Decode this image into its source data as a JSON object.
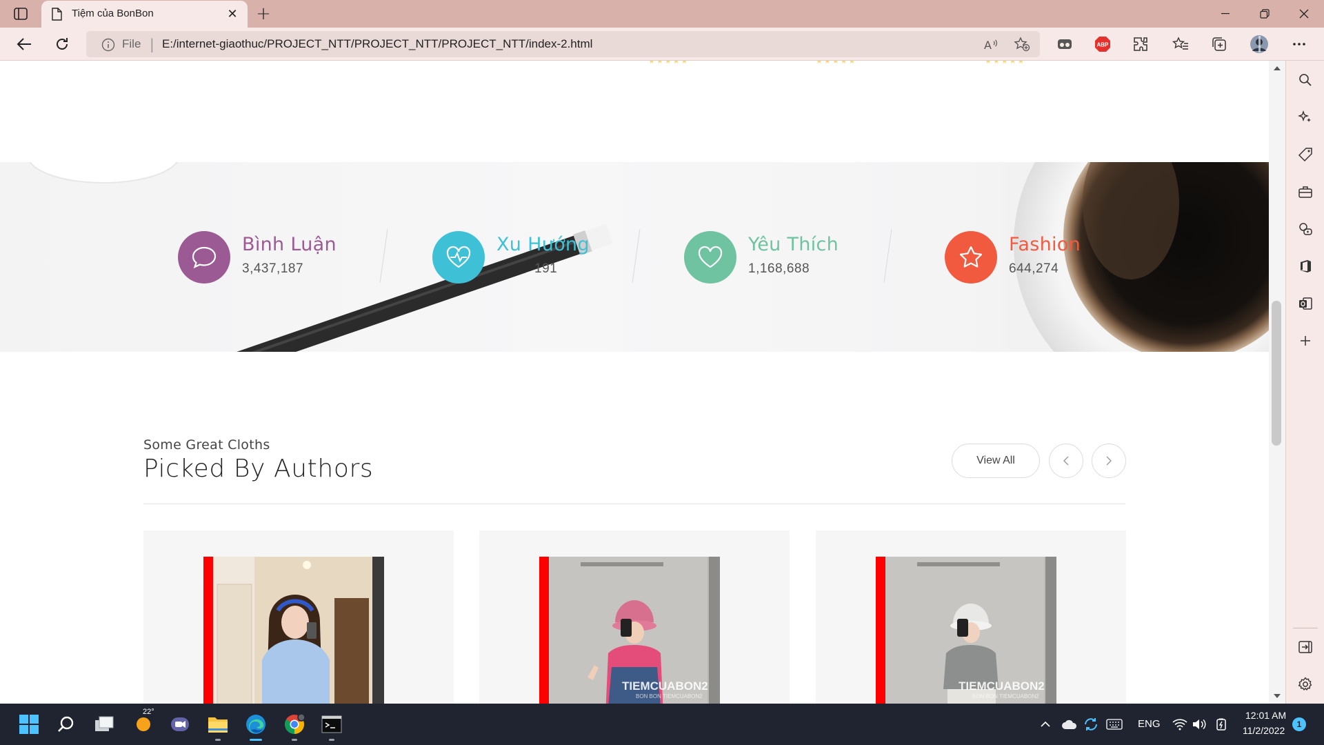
{
  "browser": {
    "tab_title": "Tiệm của BonBon",
    "address_scheme": "File",
    "address_url": "E:/internet-giaothuc/PROJECT_NTT/PROJECT_NTT/PROJECT_NTT/index-2.html"
  },
  "counters": [
    {
      "title": "Bình Luận",
      "value": "3,437,187",
      "color": "#9b5a93",
      "icon": "chat-icon"
    },
    {
      "title": "Xu Hướng",
      "value": "191",
      "color": "#3ec1d6",
      "icon": "heartbeat-icon"
    },
    {
      "title": "Yêu Thích",
      "value": "1,168,688",
      "color": "#6fc3a0",
      "icon": "heart-icon"
    },
    {
      "title": "Fashion",
      "value": "644,274",
      "color": "#f15a3f",
      "icon": "star-icon"
    }
  ],
  "section": {
    "subtitle": "Some Great Cloths",
    "title": "Picked By Authors",
    "view_all_label": "View All"
  },
  "products": [
    {
      "watermark": ""
    },
    {
      "watermark": "TIEMCUABON2",
      "watermark_sub": "BON BON TIEMCUABON2"
    },
    {
      "watermark": "TIEMCUABON2",
      "watermark_sub": "BON BON TIEMCUABON2"
    }
  ],
  "taskbar": {
    "weather_temp": "22°",
    "language": "ENG",
    "time": "12:01 AM",
    "date": "11/2/2022",
    "notification_count": "1"
  },
  "colors": {
    "accent_purple": "#9b5a93",
    "accent_cyan": "#3ec1d6",
    "accent_green": "#6fc3a0",
    "accent_orange": "#f15a3f",
    "chrome_pink": "#d8b1ab"
  }
}
